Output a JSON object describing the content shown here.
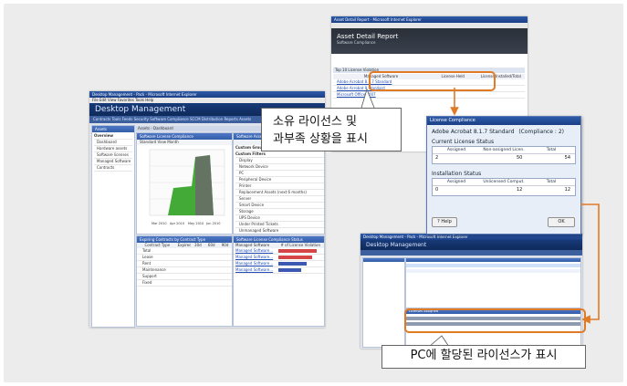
{
  "colors": {
    "accent_orange": "#e07a24",
    "title_blue": "#1f4a94",
    "banner_navy": "#173a78",
    "pane_header": "#3f69b7",
    "chart_green": "#3aa52c"
  },
  "main_window": {
    "title": "Desktop Management - Pack - Microsoft Internet Explorer",
    "menu": "File  Edit  View  Favorites  Tools  Help",
    "banner": "Desktop Management",
    "tabs": "Contracts   Tools   Feeds   Security   Software   Compliance   SCCM Distribution   Reports   Assets",
    "sidebar_title": "Assets",
    "sidebar_items": [
      "Overview",
      "Dashboard",
      "Hardware assets",
      "Software licenses",
      "Managed Software",
      "Contracts"
    ],
    "dashboard_title": "Assets - Dashboard",
    "chart_pane_title": "Software License Compliance",
    "chart_toolbar": "Standard View   Month",
    "chart_x_labels": [
      "Mar 2010",
      "Apr 2010",
      "May 2010",
      "Jun 2010"
    ],
    "groups_pane_title": "Software Assets by Groups",
    "groups_header": "Group Filter",
    "groups_items": [
      "Custom Groups",
      "Custom Filters",
      "Display",
      "Network Device",
      "PC",
      "Peripheral Device",
      "Printer",
      "Replacement Assets (next 6 months)",
      "Server",
      "Smart Device",
      "Storage",
      "UPS Device",
      "Under Printed Tickets",
      "Unmanaged Software"
    ],
    "contracts_pane_title": "Expiring Contracts by Contract Type",
    "contracts_cols": [
      "Contract Type",
      "Expired",
      "30d",
      "60d",
      "90d"
    ],
    "contracts_rows": [
      "Total",
      "Lease",
      "Rent",
      "Maintenance",
      "Support",
      "Fixed"
    ],
    "compliance_pane_title": "Software License Compliance Status",
    "compliance_cols": [
      "Managed Software",
      "# of License Violation"
    ],
    "compliance_rows": [
      "Managed Software...",
      "Managed Software...",
      "Managed Software...",
      "Managed Software..."
    ]
  },
  "report_window": {
    "title": "Asset Detail Report - Microsoft Internet Explorer",
    "heading": "Asset Detail Report",
    "subheading": "Software Compliance",
    "bar_label": "Top 10 License Violation",
    "cols": [
      "Managed Software",
      "License Held",
      "License Installed/Total"
    ],
    "rows": [
      "Adobe Acrobat 8.1.7 Standard",
      "Adobe Acrobat 9 Standard",
      "Microsoft Office 2007"
    ]
  },
  "license_dialog": {
    "title": "License Compliance",
    "product": "Adobe Acrobat 8.1.7 Standard",
    "product_note": "(Compliance : 2)",
    "current_status_label": "Current License Status",
    "current_cols": [
      "Assigned",
      "Non-assigned Licen.",
      "Total"
    ],
    "current_values": [
      "2",
      "50",
      "54"
    ],
    "install_status_label": "Installation Status",
    "install_cols": [
      "Assigned",
      "Unlicensed Comput.",
      "Total"
    ],
    "install_values": [
      "0",
      "12",
      "12"
    ],
    "help_button": "? Help",
    "ok_button": "OK"
  },
  "pc_window": {
    "title": "Desktop Management - Pack - Microsoft Internet Explorer",
    "banner": "Desktop Management",
    "lower_pane_title": "Licenses Assigned"
  },
  "callouts": {
    "top": [
      "소유 라이선스 및",
      "과부족 상황을 표시"
    ],
    "bottom": "PC에 할당된 라이선스가 표시"
  }
}
